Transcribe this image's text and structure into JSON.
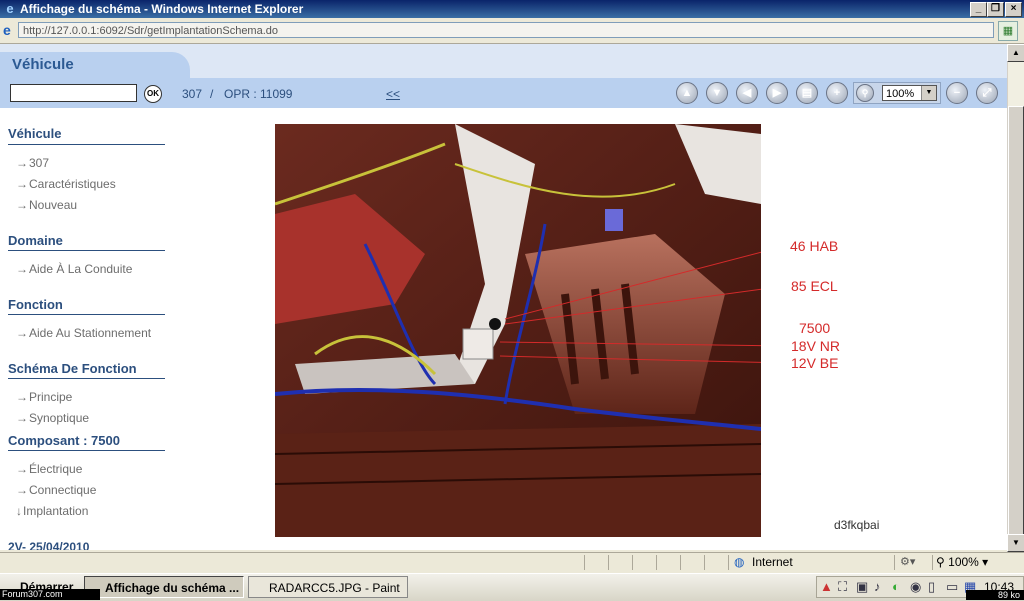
{
  "window": {
    "title": "Affichage du schéma - Windows Internet Explorer"
  },
  "address": {
    "url": "http://127.0.0.1:6092/Sdr/getImplantationSchema.do"
  },
  "header": {
    "title": "Véhicule",
    "search_button": "OK",
    "model": "307",
    "separator": "/",
    "opr": "OPR : 11099",
    "back_link": "<<",
    "zoom": "100%"
  },
  "sidebar": {
    "sections": [
      {
        "title": "Véhicule",
        "items": [
          "307",
          "Caractéristiques",
          "Nouveau"
        ]
      },
      {
        "title": "Domaine",
        "items": [
          "Aide À La Conduite"
        ]
      },
      {
        "title": "Fonction",
        "items": [
          "Aide Au Stationnement"
        ]
      },
      {
        "title": "Schéma De Fonction",
        "items": [
          "Principe",
          "Synoptique"
        ]
      },
      {
        "title": "Composant : 7500",
        "items": [
          "Électrique",
          "Connectique",
          "Implantation"
        ]
      }
    ],
    "footer": "2V- 25/04/2010"
  },
  "schema": {
    "labels": [
      "46 HAB",
      "85 ECL",
      "7500",
      "18V NR",
      "12V BE"
    ],
    "code": "d3fkqbai",
    "label_color": "#d42a2a",
    "wire_colors": [
      "#1f2fb0",
      "#c8c23a"
    ]
  },
  "status": {
    "zone": "Internet",
    "zoom": "100%"
  },
  "taskbar": {
    "start": "Démarrer",
    "tasks": [
      "Affichage du schéma ...",
      "RADARCC5.JPG - Paint"
    ],
    "clock": "10:43"
  },
  "overlay": {
    "watermark": "Forum307.com",
    "filesize": "89 ko"
  }
}
